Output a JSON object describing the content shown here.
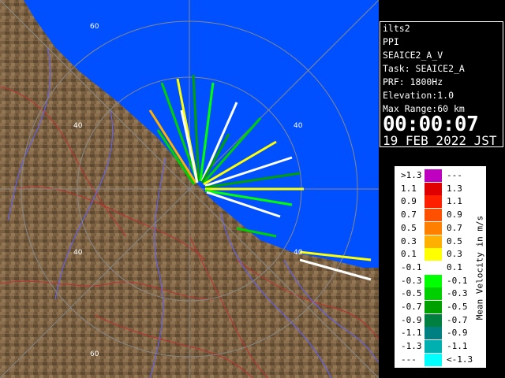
{
  "info": {
    "site": "ilts2",
    "product": "PPI",
    "scan": "SEAICE2_A_V",
    "task": "Task: SEAICE2_A",
    "prf": "PRF: 1800Hz",
    "elevation": "Elevation:1.0",
    "max_range": "Max Range:60 km",
    "time": "00:00:07",
    "date": "19 FEB 2022 JST"
  },
  "legend": {
    "title": "Mean Velocity in m/s",
    "rows": [
      {
        "left": ">1.3",
        "right": "---",
        "color": "#c000c0"
      },
      {
        "left": "1.1",
        "right": "1.3",
        "color": "#e00000"
      },
      {
        "left": "0.9",
        "right": "1.1",
        "color": "#ff2000"
      },
      {
        "left": "0.7",
        "right": "0.9",
        "color": "#ff5000"
      },
      {
        "left": "0.5",
        "right": "0.7",
        "color": "#ff8000"
      },
      {
        "left": "0.3",
        "right": "0.5",
        "color": "#ffb000"
      },
      {
        "left": "0.1",
        "right": "0.3",
        "color": "#ffff00"
      },
      {
        "left": "-0.1",
        "right": "0.1",
        "color": "#ffffff"
      },
      {
        "left": "-0.3",
        "right": "-0.1",
        "color": "#00ff00"
      },
      {
        "left": "-0.5",
        "right": "-0.3",
        "color": "#00d000"
      },
      {
        "left": "-0.7",
        "right": "-0.5",
        "color": "#00a000"
      },
      {
        "left": "-0.9",
        "right": "-0.7",
        "color": "#008040"
      },
      {
        "left": "-1.1",
        "right": "-0.9",
        "color": "#008080"
      },
      {
        "left": "-1.3",
        "right": "-1.1",
        "color": "#00b0b0"
      },
      {
        "left": "---",
        "right": "<-1.3",
        "color": "#00ffff"
      }
    ]
  },
  "range_rings": {
    "labels": [
      "60",
      "40",
      "40",
      "40",
      "40",
      "60"
    ]
  },
  "colors": {
    "sea": "#0050ff",
    "land": "#7a6040",
    "river": "#6060ff",
    "boundary": "#c03030"
  }
}
